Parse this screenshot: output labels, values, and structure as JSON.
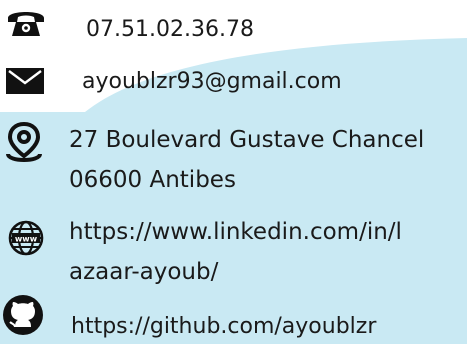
{
  "background": {
    "page_color": "#c9e9f3",
    "top_area_color": "#ffffff"
  },
  "contact": {
    "phone": {
      "icon": "telephone-icon",
      "text": "07.51.02.36.78"
    },
    "email": {
      "icon": "envelope-icon",
      "text": "ayoublzr93@gmail.com"
    },
    "address": {
      "icon": "map-pin-icon",
      "line1": "27 Boulevard Gustave Chancel",
      "line2": "06600 Antibes"
    },
    "linkedin": {
      "icon": "globe-www-icon",
      "line1": "https://www.linkedin.com/in/l",
      "line2": "azaar-ayoub/"
    },
    "github": {
      "icon": "github-icon",
      "text": "https://github.com/ayoublzr"
    }
  }
}
